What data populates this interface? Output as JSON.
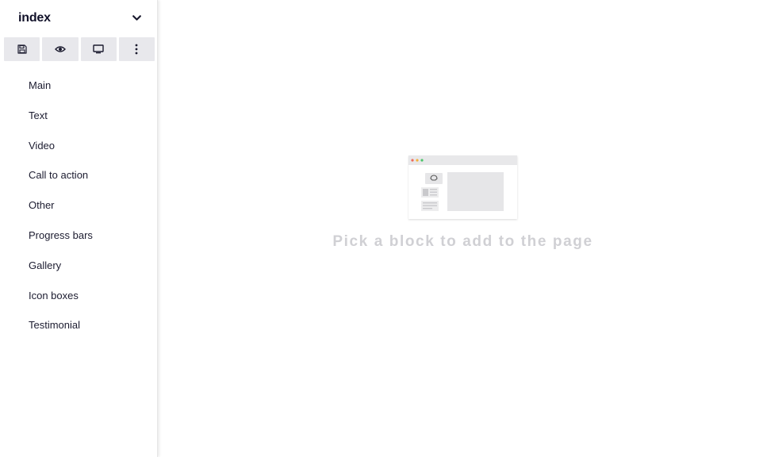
{
  "sidebar": {
    "page_select": {
      "value": "index",
      "icon": "chevron-down-icon"
    },
    "toolbar": [
      {
        "name": "save",
        "icon": "floppy-disk-icon"
      },
      {
        "name": "preview",
        "icon": "eye-icon"
      },
      {
        "name": "device",
        "icon": "desktop-monitor-icon"
      },
      {
        "name": "more",
        "icon": "vertical-ellipsis-icon"
      }
    ],
    "block_categories": [
      {
        "label": "Main"
      },
      {
        "label": "Text"
      },
      {
        "label": "Video"
      },
      {
        "label": "Call to action"
      },
      {
        "label": "Other"
      },
      {
        "label": "Progress bars"
      },
      {
        "label": "Gallery"
      },
      {
        "label": "Icon boxes"
      },
      {
        "label": "Testimonial"
      }
    ]
  },
  "main": {
    "empty_state": {
      "message": "Pick a block to add to the page",
      "illustration": "browser-window-illustration"
    }
  },
  "colors": {
    "text_dark": "#12122a",
    "toolbar_bg": "#e8e8ec",
    "empty_text": "#d0d0d4",
    "dot_red": "#f06a5a",
    "dot_yellow": "#f4b13d",
    "dot_green": "#4cc46a"
  }
}
